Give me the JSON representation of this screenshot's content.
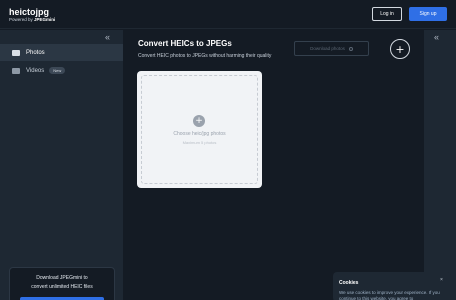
{
  "header": {
    "logo": "heictojpg",
    "powered_prefix": "Powered by ",
    "powered_brand": "JPEGmini",
    "login_label": "Log in",
    "signup_label": "Sign up"
  },
  "sidebar": {
    "collapse_icon": "«",
    "items": [
      {
        "label": "Photos",
        "icon": "photo-icon"
      },
      {
        "label": "Videos",
        "icon": "video-icon",
        "badge": "New"
      }
    ],
    "promo": {
      "line1": "Download JPEGmini to",
      "line2": "convert unlimited HEIC files"
    }
  },
  "main": {
    "title": "Convert HEICs to JPEGs",
    "subtitle": "Convert HEIC photos to JPEGs without harming their quality",
    "download_label": "Download photos",
    "add_icon": "+",
    "dropzone": {
      "upload_icon": "+",
      "choose_label": "Choose heic/jpg photos",
      "max_label": "Maximum 5 photos"
    }
  },
  "right_panel": {
    "collapse_icon": "«"
  },
  "cookies": {
    "title": "Cookies",
    "close_icon": "×",
    "text": "We use cookies to improve your experience. If you continue to this website, you agree to"
  },
  "colors": {
    "accent": "#2f6fe6",
    "background": "#141b24",
    "sidebar": "#1e2833"
  }
}
